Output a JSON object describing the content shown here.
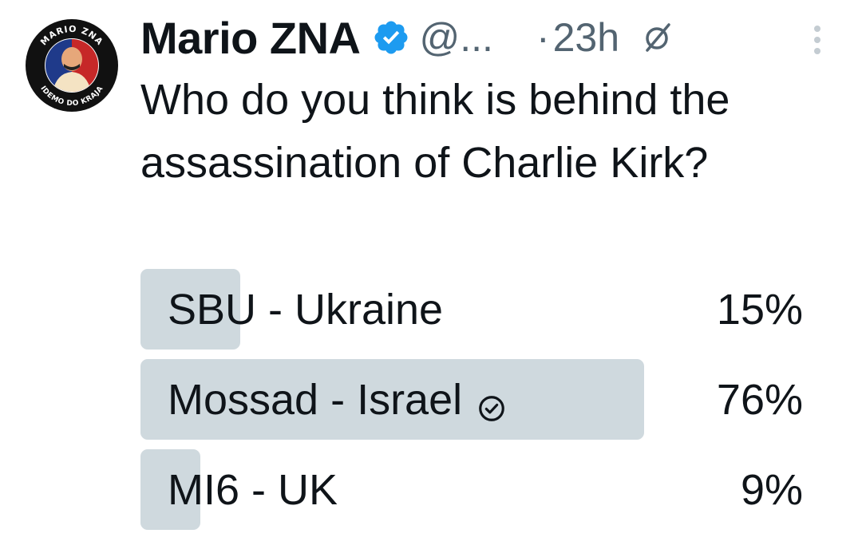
{
  "post": {
    "author": {
      "name": "Mario ZNA",
      "handle": "@...",
      "verified": true,
      "avatar_ring_text_top": "MARIO ZNA",
      "avatar_ring_text_bottom": "IDEMO DO KRAJA"
    },
    "separator": "·",
    "time": "23h",
    "text": "Who do you think is behind the assassination of Charlie Kirk?"
  },
  "poll": {
    "options": [
      {
        "label": "SBU - Ukraine",
        "percent_label": "15%",
        "percent": 15,
        "selected": false
      },
      {
        "label": "Mossad - Israel",
        "percent_label": "76%",
        "percent": 76,
        "selected": true
      },
      {
        "label": "MI6 - UK",
        "percent_label": "9%",
        "percent": 9,
        "selected": false
      }
    ]
  },
  "icons": {
    "verified": "verified-badge-icon",
    "grok": "grok-icon",
    "more": "more-vertical-icon",
    "selected": "check-circle-icon"
  },
  "colors": {
    "text": "#0f1419",
    "secondary": "#536471",
    "verified": "#1d9bf0",
    "poll_fill": "#cfd9de"
  }
}
